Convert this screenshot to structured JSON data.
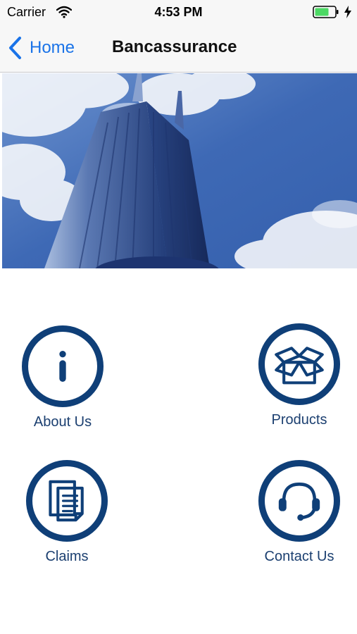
{
  "status_bar": {
    "carrier": "Carrier",
    "time": "4:53 PM",
    "icons": [
      "wifi-icon",
      "battery-icon",
      "charging-bolt-icon"
    ],
    "battery_color": "#4cd964"
  },
  "nav": {
    "back_label": "Home",
    "title": "Bancassurance",
    "back_icon": "chevron-left-icon",
    "accent_color": "#1a73e8"
  },
  "banner": {
    "image": "office-tower-photo"
  },
  "menu": {
    "brand_color": "#0f3f78",
    "items": [
      {
        "label": "About Us",
        "icon": "info-icon"
      },
      {
        "label": "Products",
        "icon": "open-box-icon"
      },
      {
        "label": "Claims",
        "icon": "documents-icon"
      },
      {
        "label": "Contact Us",
        "icon": "headset-icon"
      }
    ]
  }
}
